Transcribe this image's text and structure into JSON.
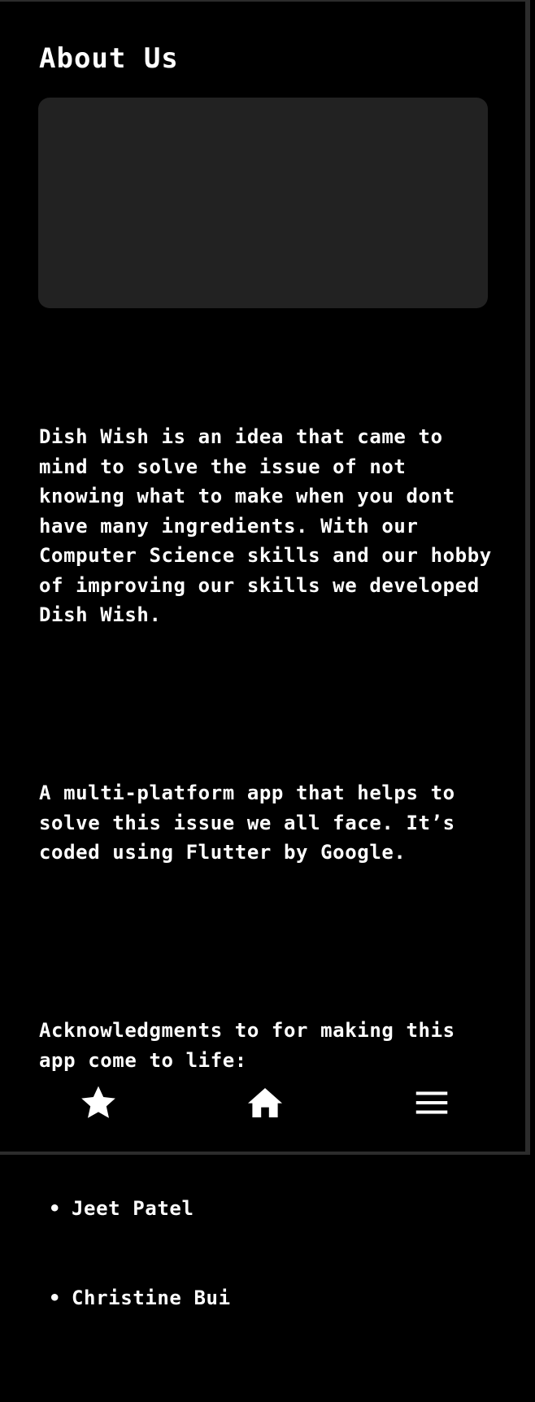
{
  "header": {
    "title": "About Us"
  },
  "about": {
    "paragraph1": "Dish Wish is an idea that came to mind to solve the issue of not knowing what to make when you dont have many ingredients. With our Computer Science skills and our hobby of improving our skills we developed Dish Wish.",
    "paragraph2": "A multi-platform app that helps to solve this issue we all face. It’s coded using Flutter by Google.",
    "acknowledgments_intro": "Acknowledgments to for making this app come to life:",
    "acknowledgments": [
      "Jeet Patel",
      "Christine Bui"
    ]
  },
  "bottom_nav": {
    "items": [
      {
        "icon": "star-icon"
      },
      {
        "icon": "home-icon"
      },
      {
        "icon": "menu-icon"
      }
    ]
  },
  "colors": {
    "background": "#000000",
    "text": "#ffffff",
    "placeholder": "#222222"
  }
}
